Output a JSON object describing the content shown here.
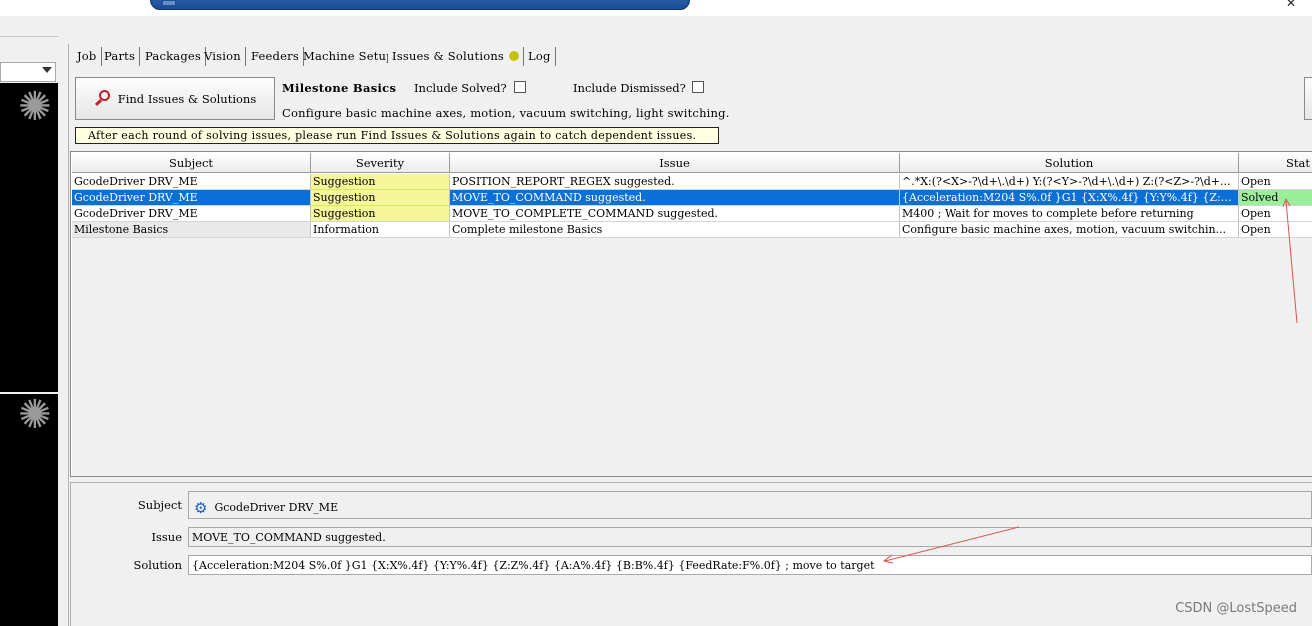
{
  "tabs": [
    {
      "label": "Job"
    },
    {
      "label": "Parts"
    },
    {
      "label": "Packages"
    },
    {
      "label": "Vision"
    },
    {
      "label": "Feeders"
    },
    {
      "label": "Machine Setup"
    },
    {
      "label": "Issues & Solutions"
    },
    {
      "label": "Log"
    }
  ],
  "toolbar": {
    "find_button_label": "Find Issues & Solutions",
    "milestone_title": "Milestone Basics",
    "include_solved_label": "Include Solved?",
    "include_dismissed_label": "Include Dismissed?",
    "milestone_description": "Configure basic machine axes, motion, vacuum switching, light switching.",
    "hint": "After each round of solving issues, please run Find Issues & Solutions again to catch dependent issues."
  },
  "table": {
    "headers": [
      "Subject",
      "Severity",
      "Issue",
      "Solution",
      "Stat"
    ],
    "rows": [
      {
        "subject": "GcodeDriver DRV_ME",
        "severity": "Suggestion",
        "issue": "POSITION_REPORT_REGEX suggested.",
        "solution": "^.*X:(?<X>-?\\d+\\.\\d+) Y:(?<Y>-?\\d+\\.\\d+) Z:(?<Z>-?\\d+...",
        "status": "Open"
      },
      {
        "subject": "GcodeDriver DRV_ME",
        "severity": "Suggestion",
        "issue": "MOVE_TO_COMMAND suggested.",
        "solution": "{Acceleration:M204 S%.0f }G1 {X:X%.4f} {Y:Y%.4f} {Z:Z...",
        "status": "Solved"
      },
      {
        "subject": "GcodeDriver DRV_ME",
        "severity": "Suggestion",
        "issue": "MOVE_TO_COMPLETE_COMMAND suggested.",
        "solution": "M400 ; Wait for moves to complete before returning",
        "status": "Open"
      },
      {
        "subject": "Milestone Basics",
        "severity": "Information",
        "issue": "Complete milestone Basics",
        "solution": "Configure basic machine axes, motion, vacuum switchin...",
        "status": "Open"
      }
    ]
  },
  "detail": {
    "subject_label": "Subject",
    "subject_value": "GcodeDriver DRV_ME",
    "issue_label": "Issue",
    "issue_value": "MOVE_TO_COMMAND suggested.",
    "solution_label": "Solution",
    "solution_value": "{Acceleration:M204 S%.0f }G1 {X:X%.4f} {Y:Y%.4f} {Z:Z%.4f} {A:A%.4f} {B:B%.4f} {FeedRate:F%.0f} ; move to target"
  },
  "watermark": "CSDN @LostSpeed",
  "colors": {
    "selection": "#0a6fd6",
    "suggestion": "#f5f59a",
    "solved": "#9bef9b",
    "status_dot": "#c7c20e",
    "annotation": "#e05050"
  },
  "icons": {
    "find_button": "search-icon",
    "subject": "gear-icon",
    "camera": "sun-icon",
    "close": "close-icon"
  }
}
